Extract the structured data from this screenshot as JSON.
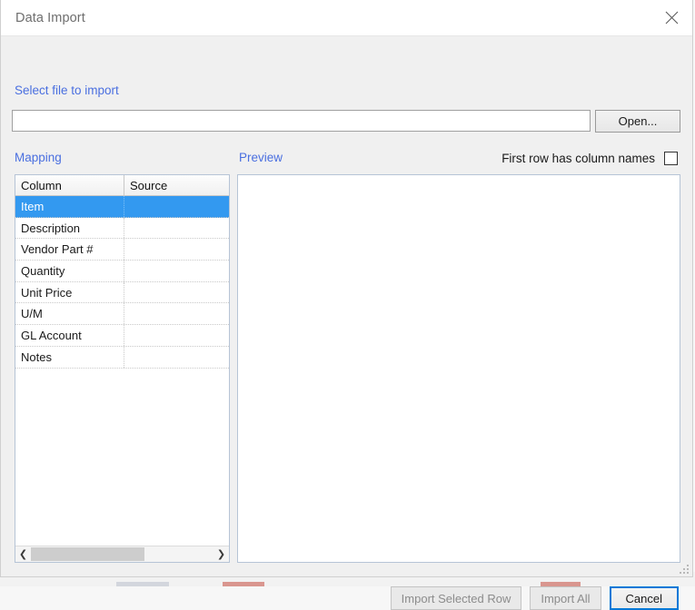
{
  "window": {
    "title": "Data Import",
    "close_icon": "close-icon"
  },
  "sections": {
    "select_file_label": "Select file to import",
    "mapping_label": "Mapping",
    "preview_label": "Preview"
  },
  "file_row": {
    "path_value": "",
    "path_placeholder": "",
    "open_button_label": "Open..."
  },
  "options": {
    "first_row_label": "First row has column names",
    "first_row_checked": false
  },
  "mapping_grid": {
    "columns": [
      "Column",
      "Source"
    ],
    "rows": [
      {
        "column": "Item",
        "source": "",
        "selected": true
      },
      {
        "column": "Description",
        "source": "",
        "selected": false
      },
      {
        "column": "Vendor Part #",
        "source": "",
        "selected": false
      },
      {
        "column": "Quantity",
        "source": "",
        "selected": false
      },
      {
        "column": "Unit Price",
        "source": "",
        "selected": false
      },
      {
        "column": "U/M",
        "source": "",
        "selected": false
      },
      {
        "column": "GL Account",
        "source": "",
        "selected": false
      },
      {
        "column": "Notes",
        "source": "",
        "selected": false
      }
    ],
    "hscroll": {
      "left_arrow_icon": "chevron-left-icon",
      "right_arrow_icon": "chevron-right-icon",
      "thumb_fraction_percent": 62
    }
  },
  "preview": {
    "content": ""
  },
  "footer": {
    "import_selected_label": "Import  Selected Row",
    "import_selected_disabled": true,
    "import_all_label": "Import All",
    "import_all_disabled": true,
    "cancel_label": "Cancel",
    "cancel_focused": true
  },
  "colors": {
    "selection_blue": "#3399f0",
    "link_blue": "#4a6fe0",
    "focus_blue": "#0078d7",
    "dialog_bg": "#f0f0f0",
    "panel_border": "#b6c4d6"
  }
}
